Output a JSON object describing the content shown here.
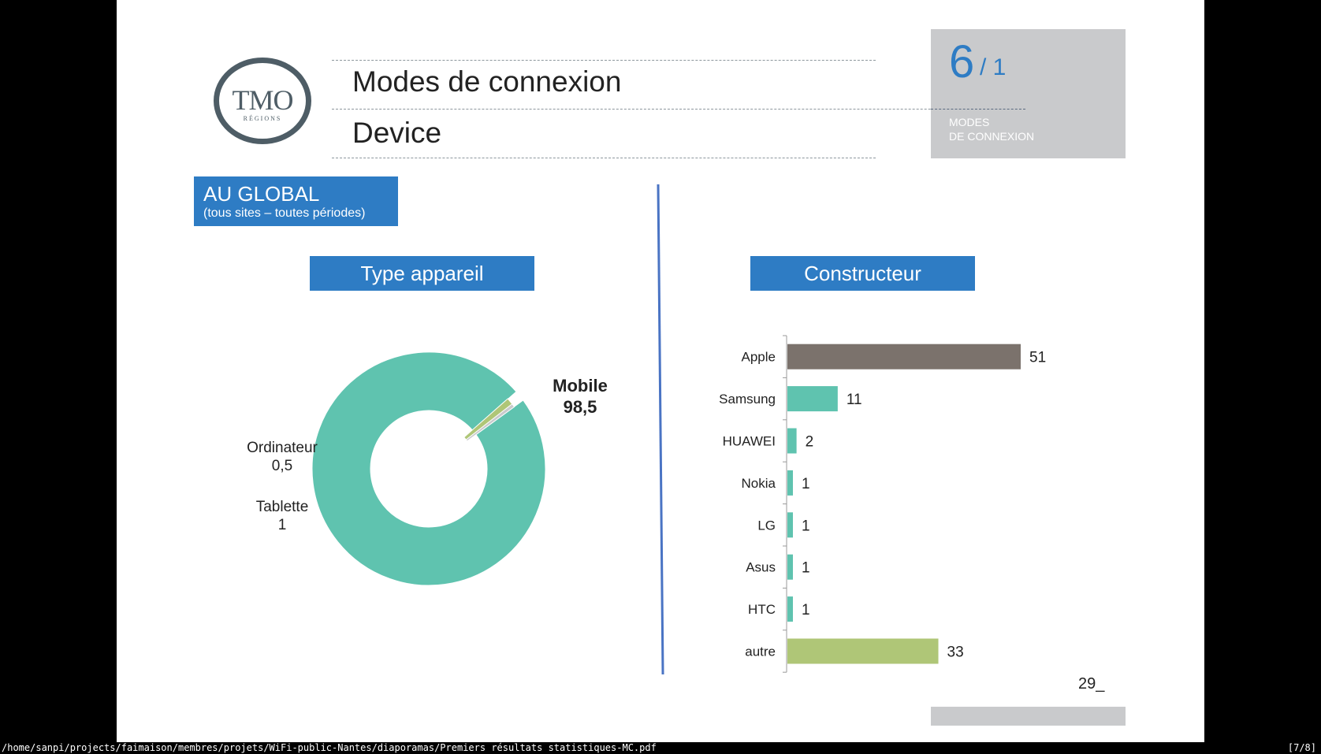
{
  "logo": {
    "main": "TMO",
    "sub": "RÉGIONS"
  },
  "header": {
    "title": "Modes de connexion",
    "subtitle": "Device"
  },
  "badge": {
    "number": "6",
    "of": "/ 1",
    "line1": "MODES",
    "line2": "DE CONNEXION"
  },
  "scope": {
    "title": "AU GLOBAL",
    "subtitle": "(tous sites – toutes périodes)"
  },
  "sections": {
    "left": "Type appareil",
    "right": "Constructeur"
  },
  "colors": {
    "accent": "#2e7cc4",
    "teal": "#5fc3af",
    "olive": "#afc677",
    "brown": "#7b726c",
    "grey": "#c9cacc"
  },
  "chart_data": [
    {
      "type": "pie",
      "variant": "donut",
      "title": "Type appareil",
      "slices": [
        {
          "label": "Mobile",
          "value": 98.5,
          "display": "98,5",
          "color": "#5fc3af"
        },
        {
          "label": "Ordinateur",
          "value": 0.5,
          "display": "0,5",
          "color": "#c9cacc"
        },
        {
          "label": "Tablette",
          "value": 1,
          "display": "1",
          "color": "#afc677"
        }
      ]
    },
    {
      "type": "bar",
      "orientation": "horizontal",
      "title": "Constructeur",
      "categories": [
        "Apple",
        "Samsung",
        "HUAWEI",
        "Nokia",
        "LG",
        "Asus",
        "HTC",
        "autre"
      ],
      "values": [
        51,
        11,
        2,
        1,
        1,
        1,
        1,
        33
      ],
      "colors": [
        "#7b726c",
        "#5fc3af",
        "#5fc3af",
        "#5fc3af",
        "#5fc3af",
        "#5fc3af",
        "#5fc3af",
        "#afc677"
      ]
    }
  ],
  "page_number": "29_",
  "statusbar": {
    "path": "/home/sanpi/projects/faimaison/membres/projets/WiFi-public-Nantes/diaporamas/Premiers résultats statistiques-MC.pdf",
    "page": "[7/8]"
  }
}
